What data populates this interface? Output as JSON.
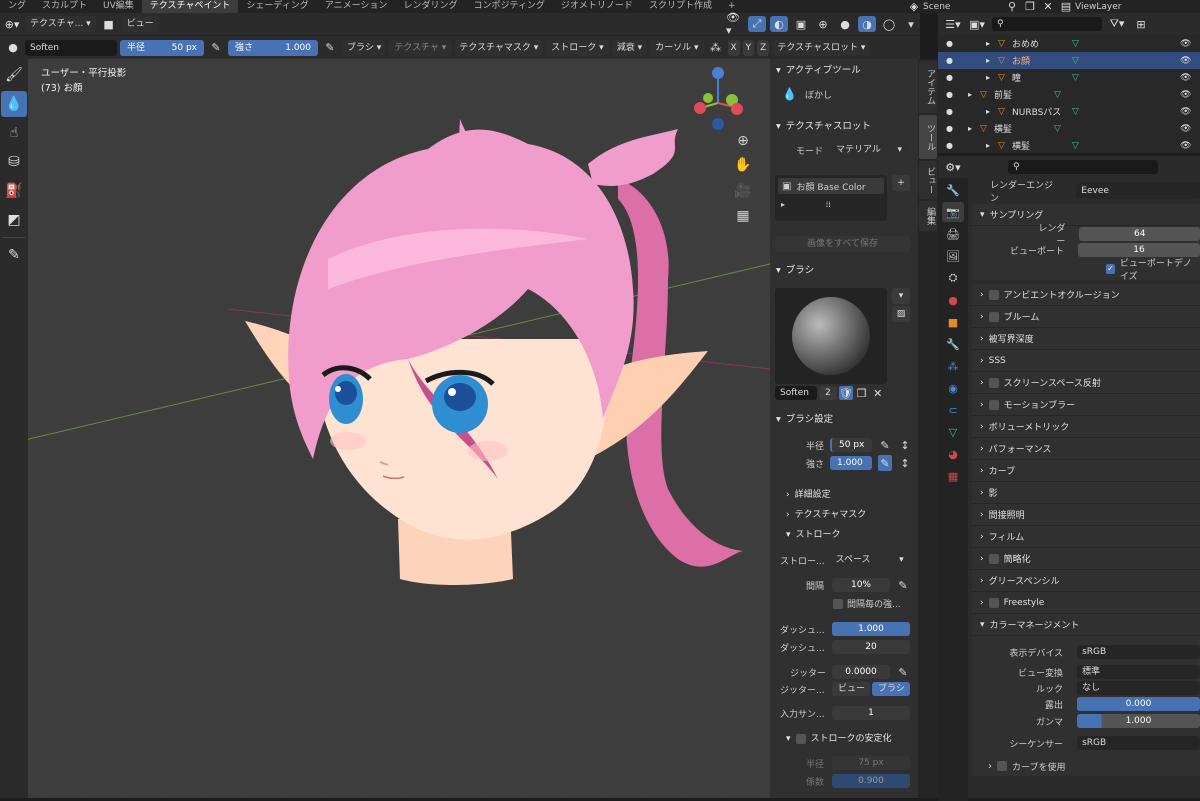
{
  "workspaces": [
    "ング",
    "スカルプト",
    "UV編集",
    "テクスチャペイント",
    "シェーディング",
    "アニメーション",
    "レンダリング",
    "コンポジティング",
    "ジオメトリノード",
    "スクリプト作成",
    "+"
  ],
  "scene": {
    "scene_name": "Scene",
    "view_layer": "ViewLayer"
  },
  "header": {
    "mode_label": "テクスチャ...",
    "view_menu": "ビュー"
  },
  "toolbar": {
    "brush_name": "Soften",
    "radius_label": "半径",
    "radius_value": "50 px",
    "strength_label": "強さ",
    "strength_value": "1.000",
    "brush_menu": "ブラシ",
    "texture_menu": "テクスチャ",
    "texture_mask_menu": "テクスチャマスク",
    "stroke_menu": "ストローク",
    "falloff_menu": "減衰",
    "cursor_menu": "カーソル",
    "axes": [
      "X",
      "Y",
      "Z"
    ],
    "texture_slot_menu": "テクスチャスロット"
  },
  "viewport": {
    "overlay_title": "ユーザー・平行投影",
    "overlay_object": "(73) お顔"
  },
  "npanel": {
    "tabs": [
      "アイテム",
      "ツール",
      "ビュー",
      "編集"
    ],
    "active_tool_title": "アクティブツール",
    "active_tool_name": "ぼかし",
    "texture_slots_title": "テクスチャスロット",
    "mode_label": "モード",
    "mode_value": "マテリアル",
    "slot_item": "お顔 Base Color",
    "save_all": "画像をすべて保存",
    "brush_title": "ブラシ",
    "brush_name": "Soften",
    "brush_users": "2",
    "brush_settings_title": "ブラシ設定",
    "radius_label": "半径",
    "radius_value": "50 px",
    "strength_label": "強さ",
    "strength_value": "1.000",
    "advanced": "詳細設定",
    "texture_mask": "テクスチャマスク",
    "stroke": "ストローク",
    "stroke_method_label": "ストロー...",
    "stroke_method_value": "スペース",
    "spacing_label": "間隔",
    "spacing_value": "10%",
    "per_step": "間隔毎の強...",
    "dash1_label": "ダッシュ...",
    "dash1_value": "1.000",
    "dash2_label": "ダッシュ...",
    "dash2_value": "20",
    "jitter_label": "ジッター",
    "jitter_value": "0.0000",
    "jitter_unit_label": "ジッター...",
    "jitter_view": "ビュー",
    "jitter_brush": "ブラシ",
    "input_samples_label": "入力サン...",
    "input_samples_value": "1",
    "stabilize_title": "ストロークの安定化",
    "stab_radius_label": "半径",
    "stab_radius_value": "75 px",
    "stab_factor_label": "係数",
    "stab_factor_value": "0.900"
  },
  "outliner": {
    "items": [
      {
        "name": "おめめ",
        "indent": 1,
        "selected": false
      },
      {
        "name": "お顔",
        "indent": 1,
        "selected": true
      },
      {
        "name": "瞳",
        "indent": 1,
        "selected": false
      },
      {
        "name": "前髪",
        "indent": 0,
        "selected": false
      },
      {
        "name": "NURBSパス",
        "indent": 1,
        "selected": false
      },
      {
        "name": "横髪",
        "indent": 0,
        "selected": false
      },
      {
        "name": "横髪",
        "indent": 1,
        "selected": false
      }
    ]
  },
  "properties": {
    "render_engine_label": "レンダーエンジン",
    "render_engine_value": "Eevee",
    "sampling_title": "サンプリング",
    "render_label": "レンダー",
    "render_value": "64",
    "viewport_label": "ビューポート",
    "viewport_value": "16",
    "denoise": "ビューポートデノイズ",
    "sections": [
      "アンビエントオクルージョン",
      "ブルーム",
      "被写界深度",
      "SSS",
      "スクリーンスペース反射",
      "モーションブラー",
      "ボリューメトリック",
      "パフォーマンス",
      "カーブ",
      "影",
      "間接照明",
      "フィルム",
      "簡略化",
      "グリースペンシル",
      "Freestyle"
    ],
    "color_mgmt_title": "カラーマネージメント",
    "display_device_label": "表示デバイス",
    "display_device_value": "sRGB",
    "view_transform_label": "ビュー変換",
    "view_transform_value": "標準",
    "look_label": "ルック",
    "look_value": "なし",
    "exposure_label": "露出",
    "exposure_value": "0.000",
    "gamma_label": "ガンマ",
    "gamma_value": "1.000",
    "sequencer_label": "シーケンサー",
    "sequencer_value": "sRGB",
    "use_curves": "カーブを使用"
  },
  "colors": {
    "accent": "#4772b3",
    "hair": "#f19dcc",
    "skin": "#ffd9c0"
  }
}
